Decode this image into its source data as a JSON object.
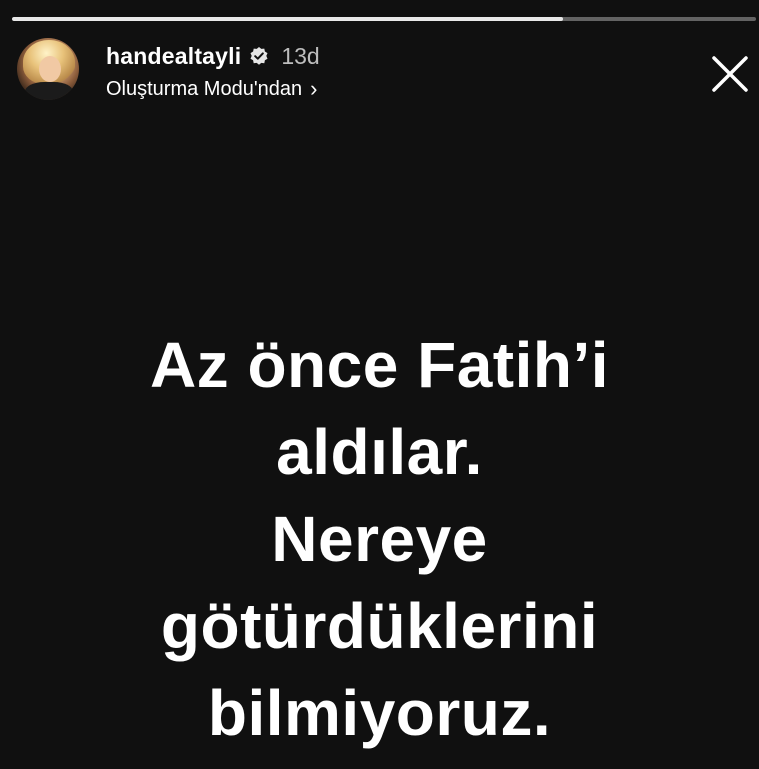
{
  "story": {
    "progress": 0.74,
    "user": {
      "username": "handealtayli",
      "verified": true,
      "time_ago": "13d",
      "mode_label": "Oluşturma Modu'ndan",
      "mode_chevron": "›"
    },
    "close_icon": "close-icon",
    "message_lines": [
      "Az önce Fatih’i",
      "aldılar.",
      "Nereye",
      "götürdüklerini",
      "bilmiyoruz."
    ]
  },
  "colors": {
    "background": "#101010",
    "text": "#ffffff",
    "muted": "#bdbdbd"
  }
}
